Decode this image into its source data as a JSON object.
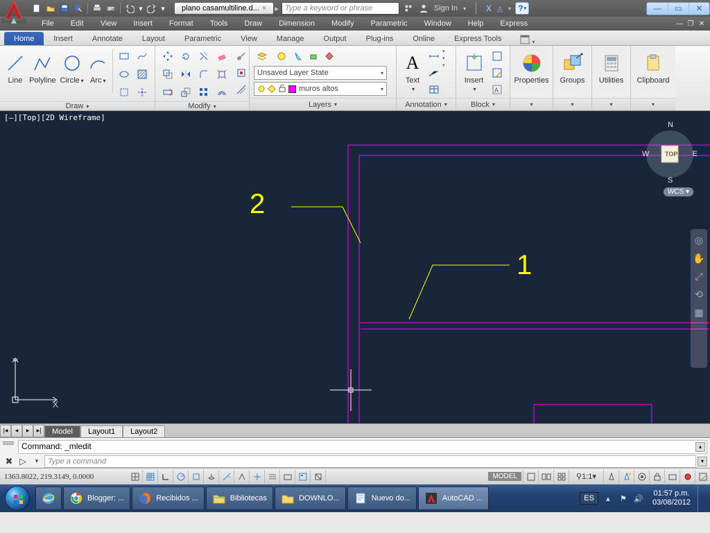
{
  "title": {
    "filename": "plano casamultiline.d...",
    "search_placeholder": "Type a keyword or phrase",
    "sign_in": "Sign In"
  },
  "menu": [
    "File",
    "Edit",
    "View",
    "Insert",
    "Format",
    "Tools",
    "Draw",
    "Dimension",
    "Modify",
    "Parametric",
    "Window",
    "Help",
    "Express"
  ],
  "ribbon_tabs": [
    "Home",
    "Insert",
    "Annotate",
    "Layout",
    "Parametric",
    "View",
    "Manage",
    "Output",
    "Plug-ins",
    "Online",
    "Express Tools"
  ],
  "panels": {
    "draw": {
      "title": "Draw",
      "line": "Line",
      "polyline": "Polyline",
      "circle": "Circle",
      "arc": "Arc"
    },
    "modify": {
      "title": "Modify"
    },
    "layers": {
      "title": "Layers",
      "state": "Unsaved Layer State",
      "current": "muros altos"
    },
    "annotation": {
      "title": "Annotation",
      "text": "Text"
    },
    "block": {
      "title": "Block",
      "insert": "Insert"
    },
    "properties": {
      "title": "Properties"
    },
    "groups": {
      "title": "Groups"
    },
    "utilities": {
      "title": "Utilities"
    },
    "clipboard": {
      "title": "Clipboard"
    }
  },
  "viewport": {
    "label": "[–][Top][2D Wireframe]",
    "wcs": "WCS",
    "cube_top": "TOP",
    "n": "N",
    "s": "S",
    "e": "E",
    "w": "W",
    "annot1": "1",
    "annot2": "2",
    "ucs_x": "X",
    "ucs_y": "Y"
  },
  "layout_tabs": [
    "Model",
    "Layout1",
    "Layout2"
  ],
  "cmd": {
    "history": "Command: _mledit",
    "placeholder": "Type a command"
  },
  "status": {
    "coords": "1363.8022, 219.3149, 0.0000",
    "model": "MODEL",
    "scale": "1:1"
  },
  "taskbar": {
    "items": [
      {
        "label": "Blogger: ..."
      },
      {
        "label": "Recibidos ..."
      },
      {
        "label": "Bibliotecas"
      },
      {
        "label": "DOWNLO..."
      },
      {
        "label": "Nuevo do..."
      },
      {
        "label": "AutoCAD ..."
      }
    ],
    "lang": "ES",
    "time": "01:57 p.m.",
    "date": "03/08/2012"
  }
}
